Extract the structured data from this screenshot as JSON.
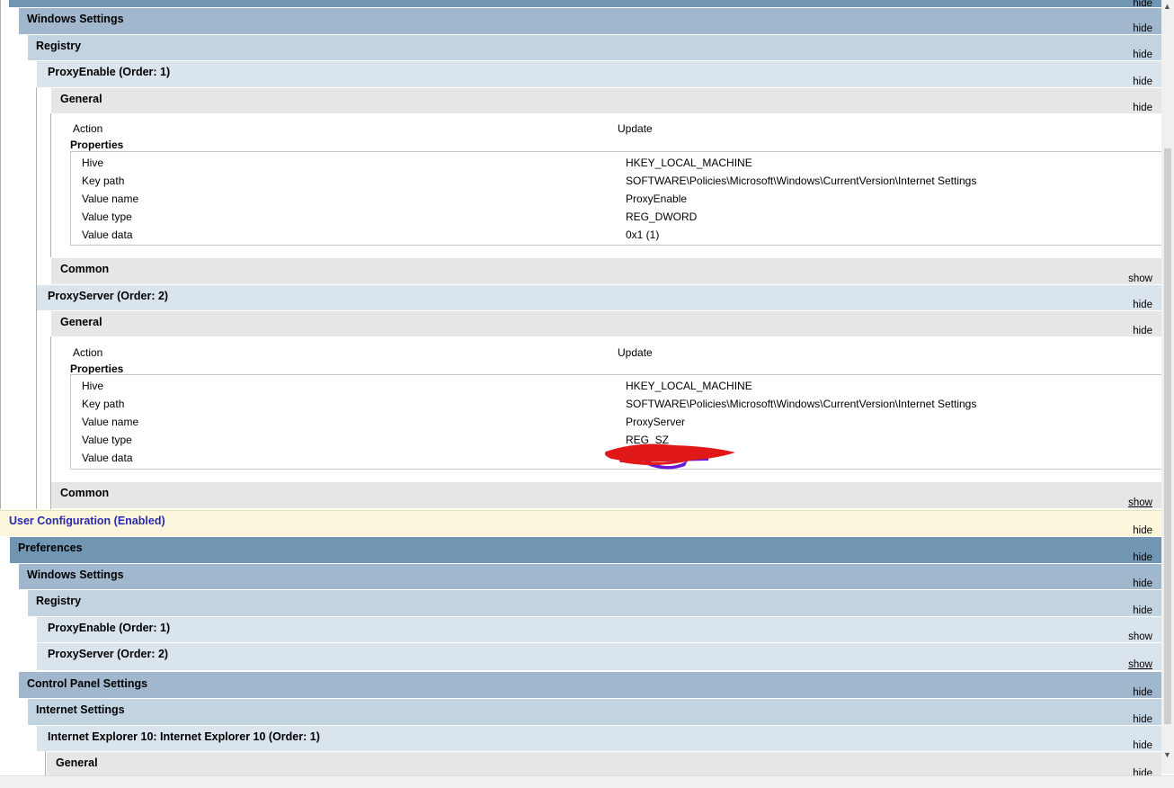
{
  "sections": {
    "windows_settings_1": {
      "title": "Windows Settings",
      "toggle": "hide"
    },
    "registry_1": {
      "title": "Registry",
      "toggle": "hide"
    },
    "proxy_enable_1": {
      "title": "ProxyEnable (Order: 1)",
      "toggle": "hide"
    },
    "general_1": {
      "title": "General",
      "toggle": "hide"
    },
    "common_1": {
      "title": "Common",
      "toggle": "show"
    },
    "proxy_server_1": {
      "title": "ProxyServer (Order: 2)",
      "toggle": "hide"
    },
    "general_2": {
      "title": "General",
      "toggle": "hide"
    },
    "common_2": {
      "title": "Common",
      "toggle": "show"
    },
    "user_config": {
      "title": "User Configuration (Enabled)",
      "toggle": "hide"
    },
    "preferences": {
      "title": "Preferences",
      "toggle": "hide"
    },
    "windows_settings_2": {
      "title": "Windows Settings",
      "toggle": "hide"
    },
    "registry_2": {
      "title": "Registry",
      "toggle": "hide"
    },
    "proxy_enable_2": {
      "title": "ProxyEnable (Order: 1)",
      "toggle": "show"
    },
    "proxy_server_2": {
      "title": "ProxyServer (Order: 2)",
      "toggle": "show"
    },
    "control_panel": {
      "title": "Control Panel Settings",
      "toggle": "hide"
    },
    "internet_settings": {
      "title": "Internet Settings",
      "toggle": "hide"
    },
    "ie10": {
      "title": "Internet Explorer 10: Internet Explorer 10 (Order: 1)",
      "toggle": "hide"
    },
    "general_3": {
      "title": "General",
      "toggle": "hide"
    },
    "top_bar": {
      "toggle": "hide"
    }
  },
  "proxy_enable_general": {
    "action_label": "Action",
    "action_value": "Update",
    "properties_label": "Properties",
    "rows": [
      {
        "label": "Hive",
        "value": "HKEY_LOCAL_MACHINE"
      },
      {
        "label": "Key path",
        "value": "SOFTWARE\\Policies\\Microsoft\\Windows\\CurrentVersion\\Internet Settings"
      },
      {
        "label": "Value name",
        "value": "ProxyEnable"
      },
      {
        "label": "Value type",
        "value": "REG_DWORD"
      },
      {
        "label": "Value data",
        "value": "0x1 (1)"
      }
    ]
  },
  "proxy_server_general": {
    "action_label": "Action",
    "action_value": "Update",
    "properties_label": "Properties",
    "rows": [
      {
        "label": "Hive",
        "value": "HKEY_LOCAL_MACHINE"
      },
      {
        "label": "Key path",
        "value": "SOFTWARE\\Policies\\Microsoft\\Windows\\CurrentVersion\\Internet Settings"
      },
      {
        "label": "Value name",
        "value": "ProxyServer"
      },
      {
        "label": "Value type",
        "value": "REG_SZ"
      },
      {
        "label": "Value data",
        "value": ""
      }
    ]
  },
  "colors": {
    "level1": "#7096b4",
    "level2": "#a0b7cd",
    "level3": "#c2d3e1",
    "level4": "#dae4ec",
    "level5": "#e6e6e6",
    "user_config_bg": "#fbf6dc",
    "user_config_text": "#2a2ab0",
    "redaction_red": "#e01818",
    "redaction_purple": "#6a18d8"
  },
  "icons": {
    "scroll_up": "chevron-up-icon",
    "scroll_down": "chevron-down-icon"
  }
}
